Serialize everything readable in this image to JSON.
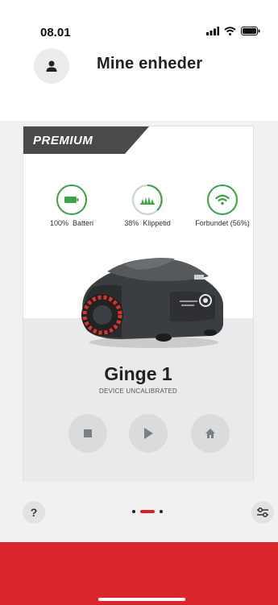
{
  "status_bar": {
    "time": "08.01",
    "icons": [
      "signal-icon",
      "wifi-icon",
      "battery-icon"
    ]
  },
  "header": {
    "title": "Mine enheder",
    "avatar_icon": "user-icon"
  },
  "device_card": {
    "badge": "PREMIUM",
    "stats": [
      {
        "icon": "battery-icon",
        "value": "100%",
        "label": "Batteri"
      },
      {
        "icon": "grass-icon",
        "value": "38%",
        "label": "Klippetid"
      },
      {
        "icon": "wifi-icon",
        "value": "",
        "label": "Forbundet (56%)"
      }
    ],
    "name": "Ginge 1",
    "status": "DEVICE UNCALIBRATED",
    "controls": [
      "stop-icon",
      "play-icon",
      "home-icon"
    ]
  },
  "footer": {
    "help_label": "?",
    "page_count": 3,
    "active_page": 1,
    "settings_icon": "sliders-icon"
  },
  "colors": {
    "accent_green": "#3aa346",
    "brand_red": "#d8262c",
    "badge_dark": "#4a4a4a"
  }
}
